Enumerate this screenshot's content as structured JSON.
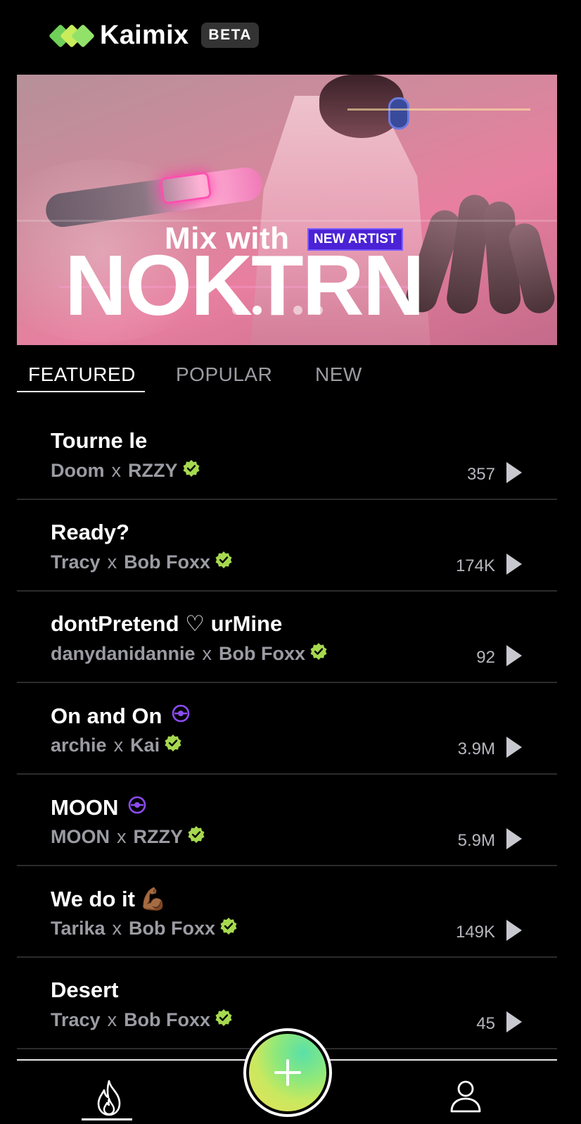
{
  "app": {
    "name": "Kaimix",
    "badge": "BETA",
    "logo_colors": [
      "#78d65a",
      "#c9ee5d",
      "#8fe46f"
    ]
  },
  "banner": {
    "heading": "Mix with",
    "tag": "NEW ARTIST",
    "artist": "NOKTRN",
    "carousel_dots": 5,
    "active_dot": 2
  },
  "tabs": [
    {
      "label": "FEATURED",
      "active": true
    },
    {
      "label": "POPULAR",
      "active": false
    },
    {
      "label": "NEW",
      "active": false
    }
  ],
  "tracks": [
    {
      "title": "Tourne le",
      "artist": "Doom",
      "partner": "RZZY",
      "count": "357",
      "exclusive": false,
      "emoji": ""
    },
    {
      "title": "Ready?",
      "artist": "Tracy",
      "partner": "Bob Foxx",
      "count": "174K",
      "exclusive": false,
      "emoji": ""
    },
    {
      "title": "dontPretend ♡ urMine",
      "artist": "danydanidannie",
      "partner": "Bob Foxx",
      "count": "92",
      "exclusive": false,
      "emoji": ""
    },
    {
      "title": "On and On",
      "artist": "archie",
      "partner": "Kai",
      "count": "3.9M",
      "exclusive": true,
      "emoji": ""
    },
    {
      "title": "MOON",
      "artist": "MOON",
      "partner": "RZZY",
      "count": "5.9M",
      "exclusive": true,
      "emoji": ""
    },
    {
      "title": "We do it",
      "artist": "Tarika",
      "partner": "Bob Foxx",
      "count": "149K",
      "exclusive": false,
      "emoji": "💪🏾"
    },
    {
      "title": "Desert",
      "artist": "Tracy",
      "partner": "Bob Foxx",
      "count": "45",
      "exclusive": false,
      "emoji": ""
    }
  ],
  "separator": "x",
  "colors": {
    "verified_badge": "#a6d94f",
    "exclusive_icon": "#8b4cf2",
    "accent_purple": "#4b22d6"
  },
  "nav": {
    "home_icon": "fire-icon",
    "add_icon": "plus-icon",
    "profile_icon": "profile-icon"
  }
}
